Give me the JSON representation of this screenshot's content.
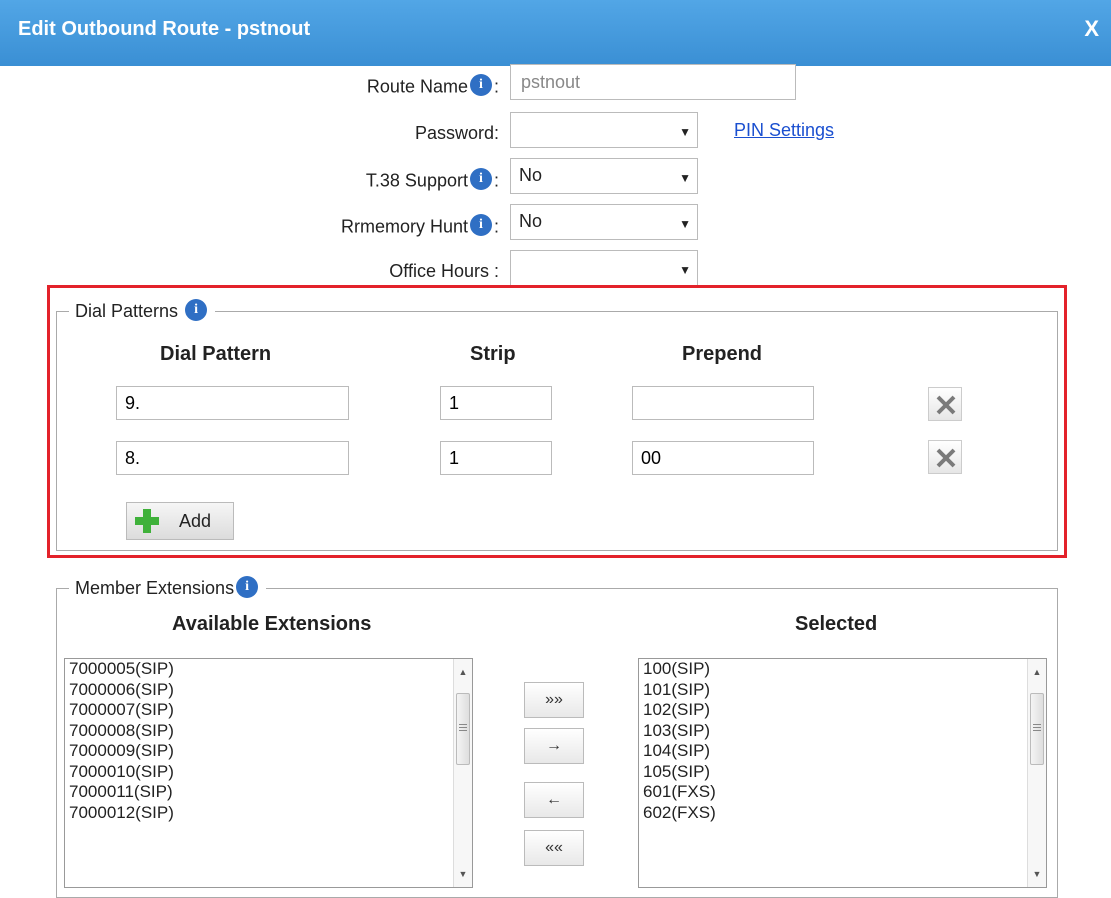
{
  "dialog": {
    "title": "Edit Outbound Route - pstnout",
    "close_label": "X"
  },
  "form": {
    "route_name": {
      "label": "Route Name",
      "value": "pstnout"
    },
    "password": {
      "label": "Password:",
      "value": "",
      "link": "PIN Settings"
    },
    "t38": {
      "label": "T.38 Support",
      "value": "No"
    },
    "rrmemory": {
      "label": "Rrmemory Hunt",
      "value": "No"
    },
    "office_hours": {
      "label": "Office Hours :",
      "value": ""
    }
  },
  "dial_patterns": {
    "legend": "Dial Patterns",
    "columns": [
      "Dial Pattern",
      "Strip",
      "Prepend"
    ],
    "rows": [
      {
        "pattern": "9.",
        "strip": "1",
        "prepend": ""
      },
      {
        "pattern": "8.",
        "strip": "1",
        "prepend": "00"
      }
    ],
    "add_label": "Add"
  },
  "members": {
    "legend": "Member Extensions",
    "available_label": "Available Extensions",
    "selected_label": "Selected",
    "available": [
      "7000005(SIP)",
      "7000006(SIP)",
      "7000007(SIP)",
      "7000008(SIP)",
      "7000009(SIP)",
      "7000010(SIP)",
      "7000011(SIP)",
      "7000012(SIP)"
    ],
    "selected": [
      "100(SIP)",
      "101(SIP)",
      "102(SIP)",
      "103(SIP)",
      "104(SIP)",
      "105(SIP)",
      "601(FXS)",
      "602(FXS)"
    ],
    "buttons": {
      "add_all": "»»",
      "add": "→",
      "remove": "←",
      "remove_all": "««"
    }
  },
  "colors": {
    "titlebar": "#3a8fd4",
    "highlight": "#e3222a",
    "link": "#1a4fd0",
    "info": "#2f6fc4"
  },
  "icons": {
    "info": "info-icon",
    "delete": "delete-icon",
    "add": "plus-icon"
  }
}
